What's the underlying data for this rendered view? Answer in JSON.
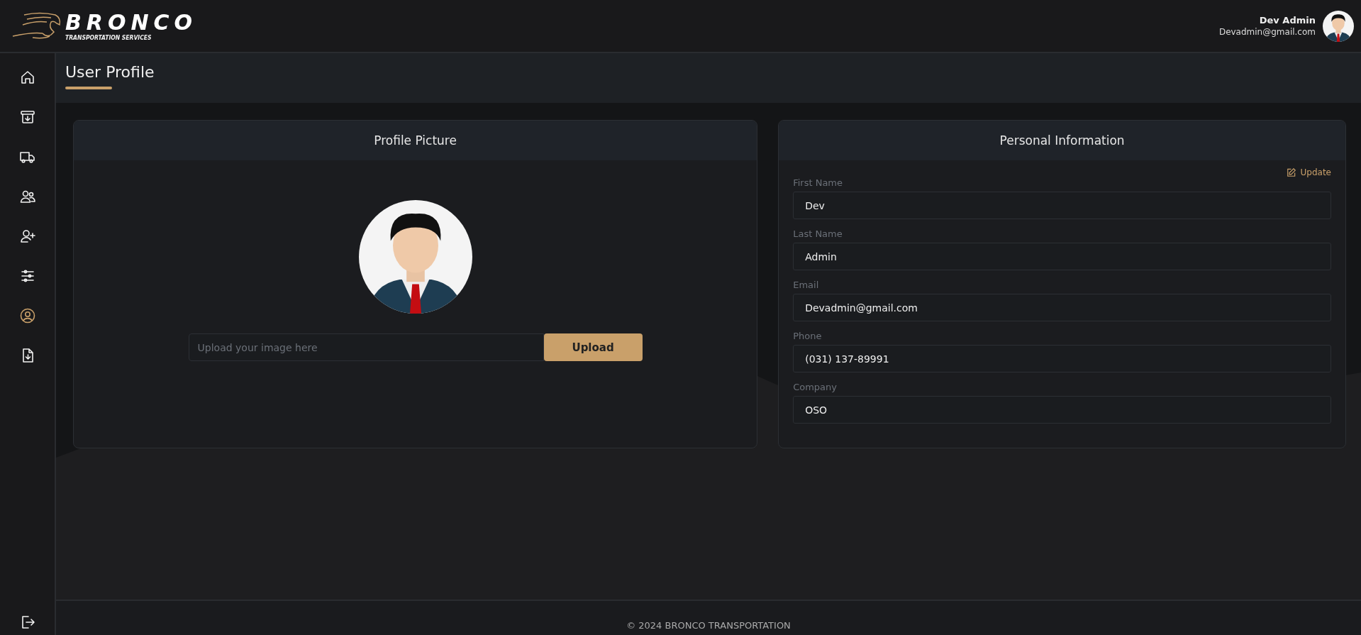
{
  "header": {
    "logo_title": "BRONCO",
    "logo_subtitle": "TRANSPORTATION SERVICES",
    "user_name": "Dev Admin",
    "user_email": "Devadmin@gmail.com"
  },
  "sidebar": {
    "items": [
      {
        "kind": "home",
        "selected": false
      },
      {
        "kind": "archive",
        "selected": false
      },
      {
        "kind": "truck",
        "selected": false
      },
      {
        "kind": "users",
        "selected": false
      },
      {
        "kind": "user-plus",
        "selected": false
      },
      {
        "kind": "sliders",
        "selected": false
      },
      {
        "kind": "user-circle",
        "selected": true
      },
      {
        "kind": "file-download",
        "selected": false
      }
    ],
    "logout": {
      "kind": "logout"
    }
  },
  "page": {
    "title": "User Profile"
  },
  "profile_picture": {
    "title": "Profile Picture",
    "upload_field": {
      "placeholder": "Upload your image here"
    },
    "upload_button": "Upload"
  },
  "personal_information": {
    "title": "Personal Information",
    "update_link": "Update",
    "fields": [
      {
        "label": "First Name",
        "value": "Dev"
      },
      {
        "label": "Last Name",
        "value": "Admin"
      },
      {
        "label": "Email",
        "value": "Devadmin@gmail.com"
      },
      {
        "label": "Phone",
        "value": "(031) 137-89991"
      },
      {
        "label": "Company",
        "value": "OSO"
      }
    ]
  },
  "footer": {
    "text": "© 2024 BRONCO TRANSPORTATION"
  }
}
